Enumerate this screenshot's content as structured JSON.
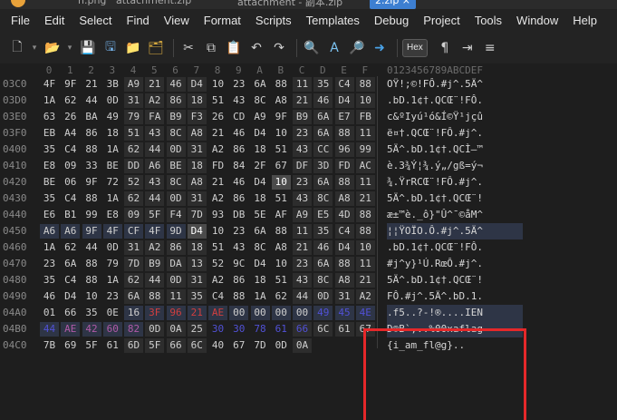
{
  "tabs": [
    {
      "label": "h.png"
    },
    {
      "label": "attachment.zip"
    },
    {
      "label": "attachment - 副本.zip"
    },
    {
      "label": "2.zip ×"
    }
  ],
  "menu": [
    "File",
    "Edit",
    "Select",
    "Find",
    "View",
    "Format",
    "Scripts",
    "Templates",
    "Debug",
    "Project",
    "Tools",
    "Window",
    "Help"
  ],
  "toolbar": {
    "hex_label": "Hex",
    "pilcrow": "¶"
  },
  "columns": [
    "0",
    "1",
    "2",
    "3",
    "4",
    "5",
    "6",
    "7",
    "8",
    "9",
    "A",
    "B",
    "C",
    "D",
    "E",
    "F"
  ],
  "ascii_header": "0123456789ABCDEF",
  "rows": [
    {
      "addr": "03C0",
      "bytes": [
        "4F",
        "9F",
        "21",
        "3B",
        "A9",
        "21",
        "46",
        "D4",
        "10",
        "23",
        "6A",
        "88",
        "11",
        "35",
        "C4",
        "88"
      ],
      "ascii": "OŸ!;©!FÔ.#j^.5Ä^"
    },
    {
      "addr": "03D0",
      "bytes": [
        "1A",
        "62",
        "44",
        "0D",
        "31",
        "A2",
        "86",
        "18",
        "51",
        "43",
        "8C",
        "A8",
        "21",
        "46",
        "D4",
        "10"
      ],
      "ascii": ".bD.1¢†.QCŒ¨!FÔ."
    },
    {
      "addr": "03E0",
      "bytes": [
        "63",
        "26",
        "BA",
        "49",
        "79",
        "FA",
        "B9",
        "F3",
        "26",
        "CD",
        "A9",
        "9F",
        "B9",
        "6A",
        "E7",
        "FB"
      ],
      "ascii": "c&ºIyú¹ó&Í©Ÿ¹jçû"
    },
    {
      "addr": "03F0",
      "bytes": [
        "EB",
        "A4",
        "86",
        "18",
        "51",
        "43",
        "8C",
        "A8",
        "21",
        "46",
        "D4",
        "10",
        "23",
        "6A",
        "88",
        "11"
      ],
      "ascii": "ë¤†.QCŒ¨!FÔ.#j^."
    },
    {
      "addr": "0400",
      "bytes": [
        "35",
        "C4",
        "88",
        "1A",
        "62",
        "44",
        "0D",
        "31",
        "A2",
        "86",
        "18",
        "51",
        "43",
        "CC",
        "96",
        "99"
      ],
      "ascii": "5Ä^.bD.1¢†.QCÌ–™"
    },
    {
      "addr": "0410",
      "bytes": [
        "E8",
        "09",
        "33",
        "BE",
        "DD",
        "A6",
        "BE",
        "18",
        "FD",
        "84",
        "2F",
        "67",
        "DF",
        "3D",
        "FD",
        "AC"
      ],
      "ascii": "è.3¾Ý¦¾.ý„/gß=ý¬"
    },
    {
      "addr": "0420",
      "bytes": [
        "BE",
        "06",
        "9F",
        "72",
        "52",
        "43",
        "8C",
        "A8",
        "21",
        "46",
        "D4",
        "10",
        "23",
        "6A",
        "88",
        "11"
      ],
      "ascii": "¾.ŸrRCŒ¨!FÔ.#j^."
    },
    {
      "addr": "0430",
      "bytes": [
        "35",
        "C4",
        "88",
        "1A",
        "62",
        "44",
        "0D",
        "31",
        "A2",
        "86",
        "18",
        "51",
        "43",
        "8C",
        "A8",
        "21"
      ],
      "ascii": "5Ä^.bD.1¢†.QCŒ¨!"
    },
    {
      "addr": "0440",
      "bytes": [
        "E6",
        "B1",
        "99",
        "E8",
        "09",
        "5F",
        "F4",
        "7D",
        "93",
        "DB",
        "5E",
        "AF",
        "A9",
        "E5",
        "4D",
        "88"
      ],
      "ascii": "æ±™è._ô}\"Û^¯©åM^"
    },
    {
      "addr": "0450",
      "bytes": [
        "A6",
        "A6",
        "9F",
        "4F",
        "CF",
        "4F",
        "9D",
        "D4",
        "10",
        "23",
        "6A",
        "88",
        "11",
        "35",
        "C4",
        "88"
      ],
      "ascii": "¦¦ŸOÏO.Ô.#j^.5Ä^"
    },
    {
      "addr": "0460",
      "bytes": [
        "1A",
        "62",
        "44",
        "0D",
        "31",
        "A2",
        "86",
        "18",
        "51",
        "43",
        "8C",
        "A8",
        "21",
        "46",
        "D4",
        "10"
      ],
      "ascii": ".bD.1¢†.QCŒ¨!FÔ."
    },
    {
      "addr": "0470",
      "bytes": [
        "23",
        "6A",
        "88",
        "79",
        "7D",
        "B9",
        "DA",
        "13",
        "52",
        "9C",
        "D4",
        "10",
        "23",
        "6A",
        "88",
        "11"
      ],
      "ascii": "#j^y}¹Ú.RœÔ.#j^."
    },
    {
      "addr": "0480",
      "bytes": [
        "35",
        "C4",
        "88",
        "1A",
        "62",
        "44",
        "0D",
        "31",
        "A2",
        "86",
        "18",
        "51",
        "43",
        "8C",
        "A8",
        "21"
      ],
      "ascii": "5Ä^.bD.1¢†.QCŒ¨!"
    },
    {
      "addr": "0490",
      "bytes": [
        "46",
        "D4",
        "10",
        "23",
        "6A",
        "88",
        "11",
        "35",
        "C4",
        "88",
        "1A",
        "62",
        "44",
        "0D",
        "31",
        "A2"
      ],
      "ascii": "FÔ.#j^.5Ä^.bD.1."
    },
    {
      "addr": "04A0",
      "bytes": [
        "01",
        "66",
        "35",
        "0E",
        "16",
        "3F",
        "96",
        "21",
        "AE",
        "00",
        "00",
        "00",
        "00",
        "49",
        "45",
        "4E"
      ],
      "ascii": ".f5..?-!®....IEN"
    },
    {
      "addr": "04B0",
      "bytes": [
        "44",
        "AE",
        "42",
        "60",
        "82",
        "0D",
        "0A",
        "25",
        "30",
        "30",
        "78",
        "61",
        "66",
        "6C",
        "61",
        "67"
      ],
      "ascii": "D®B`‚..%00xaflag"
    },
    {
      "addr": "04C0",
      "bytes": [
        "7B",
        "69",
        "5F",
        "61",
        "6D",
        "5F",
        "66",
        "6C",
        "40",
        "67",
        "7D",
        "0D",
        "0A"
      ],
      "ascii": "{i_am_fl@g}.."
    }
  ]
}
